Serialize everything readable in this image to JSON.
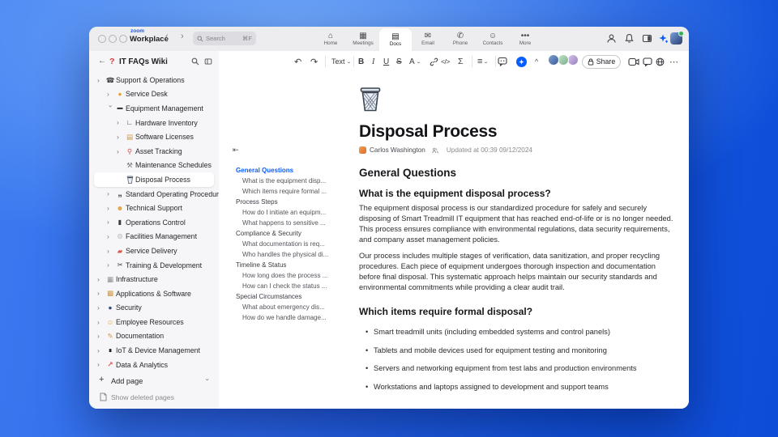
{
  "titlebar": {
    "logo_top": "zoom",
    "logo_bottom": "Workplace",
    "search_placeholder": "Search",
    "search_shortcut": "⌘F",
    "tabs": [
      {
        "icon": "⌂",
        "label": "Home"
      },
      {
        "icon": "▦",
        "label": "Meetings"
      },
      {
        "icon": "▤",
        "label": "Docs"
      },
      {
        "icon": "✉",
        "label": "Email"
      },
      {
        "icon": "✆",
        "label": "Phone"
      },
      {
        "icon": "☺",
        "label": "Contacts"
      },
      {
        "icon": "•••",
        "label": "More"
      }
    ]
  },
  "sidebar": {
    "help_icon": "?",
    "title": "IT FAQs Wiki",
    "items": [
      {
        "icon": "☎",
        "label": "Support & Operations"
      },
      {
        "icon": "●",
        "label": "Service Desk"
      },
      {
        "icon": "▬",
        "label": "Equipment Management"
      },
      {
        "icon": "∟",
        "label": "Hardware Inventory"
      },
      {
        "icon": "▤",
        "label": "Software Licenses"
      },
      {
        "icon": "⚲",
        "label": "Asset Tracking"
      },
      {
        "icon": "⚒",
        "label": "Maintenance Schedules"
      },
      {
        "icon": "",
        "label": "Disposal Process"
      },
      {
        "icon": "„",
        "label": "Standard Operating Procedures"
      },
      {
        "icon": "☻",
        "label": "Technical Support"
      },
      {
        "icon": "▮",
        "label": "Operations Control"
      },
      {
        "icon": "⚙",
        "label": "Facilities Management"
      },
      {
        "icon": "▰",
        "label": "Service Delivery"
      },
      {
        "icon": "✂",
        "label": "Training & Development"
      },
      {
        "icon": "▦",
        "label": "Infrastructure"
      },
      {
        "icon": "▩",
        "label": "Applications & Software"
      },
      {
        "icon": "●",
        "label": "Security"
      },
      {
        "icon": "☺",
        "label": "Employee Resources"
      },
      {
        "icon": "✎",
        "label": "Documentation"
      },
      {
        "icon": "∎",
        "label": "IoT & Device Management"
      },
      {
        "icon": "↗",
        "label": "Data & Analytics"
      }
    ],
    "add_label": "Add page",
    "deleted_label": "Show deleted pages"
  },
  "toc": {
    "items": [
      {
        "label": "General Questions"
      },
      {
        "label": "What is the equipment disp..."
      },
      {
        "label": "Which items require formal ..."
      },
      {
        "label": "Process Steps"
      },
      {
        "label": "How do I initiate an equipm..."
      },
      {
        "label": "What happens to sensitive ..."
      },
      {
        "label": "Compliance & Security"
      },
      {
        "label": "What documentation is req..."
      },
      {
        "label": "Who handles the physical di..."
      },
      {
        "label": "Timeline & Status"
      },
      {
        "label": "How long does the process ..."
      },
      {
        "label": "How can I check the status ..."
      },
      {
        "label": "Special Circumstances"
      },
      {
        "label": "What about emergency dis..."
      },
      {
        "label": "How do we handle damage..."
      }
    ]
  },
  "toolbar": {
    "undo": "↶",
    "redo": "↷",
    "text": "Text",
    "bold": "B",
    "italic": "I",
    "underline": "U",
    "strike": "S",
    "color": "A",
    "code": "</>",
    "formula": "Σ",
    "list": "≡",
    "caret": "^",
    "share": "Share",
    "more": "⋯"
  },
  "doc": {
    "title": "Disposal Process",
    "author": "Carlos Washington",
    "updated": "Updated at 00:39 09/12/2024",
    "h2": "General Questions",
    "q1": "What is the equipment disposal process?",
    "p1": "The equipment disposal process is our standardized procedure for safely and securely disposing of Smart Treadmill IT equipment that has reached end-of-life or is no longer needed. This process ensures compliance with environmental regulations, data security requirements, and company asset management policies.",
    "p2": "Our process includes multiple stages of verification, data sanitization, and proper recycling procedures. Each piece of equipment undergoes thorough inspection and documentation before final disposal. This systematic approach helps maintain our security standards and environmental commitments while providing a clear audit trail.",
    "q2": "Which items require formal disposal?",
    "bullets": [
      "Smart treadmill units (including embedded systems and control panels)",
      "Tablets and mobile devices used for equipment testing and monitoring",
      "Servers and networking equipment from test labs and production environments",
      "Workstations and laptops assigned to development and support teams"
    ]
  },
  "colors": {
    "accent": "#0B5CFF"
  }
}
